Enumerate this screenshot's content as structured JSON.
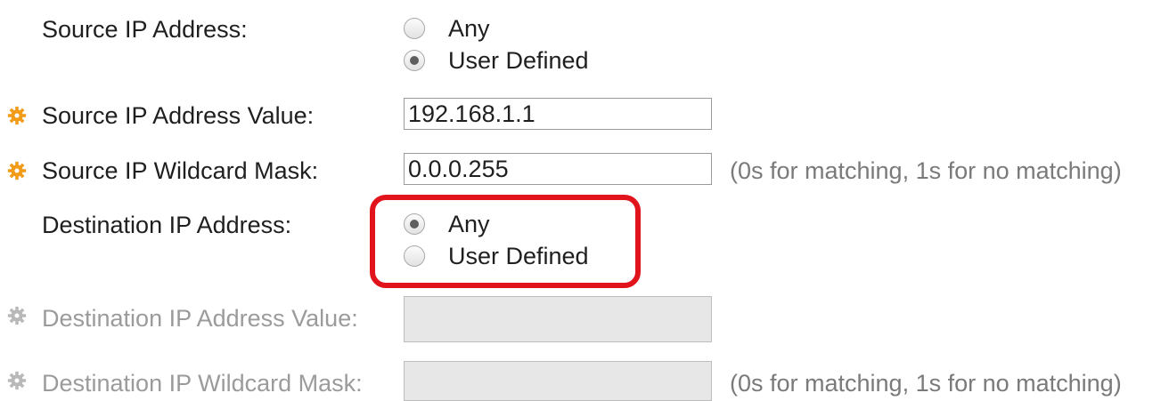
{
  "form": {
    "source_ip_address": {
      "label": "Source IP Address:",
      "options": [
        {
          "label": "Any",
          "checked": false
        },
        {
          "label": "User Defined",
          "checked": true
        }
      ]
    },
    "source_ip_address_value": {
      "label": "Source IP Address Value:",
      "value": "192.168.1.1",
      "required_icon": "gear-icon"
    },
    "source_ip_wildcard_mask": {
      "label": "Source IP Wildcard Mask:",
      "value": "0.0.0.255",
      "hint": "(0s for matching, 1s for no matching)",
      "required_icon": "gear-icon"
    },
    "destination_ip_address": {
      "label": "Destination IP Address:",
      "options": [
        {
          "label": "Any",
          "checked": true
        },
        {
          "label": "User Defined",
          "checked": false
        }
      ]
    },
    "destination_ip_address_value": {
      "label": "Destination IP Address Value:",
      "value": "",
      "required_icon": "gear-icon"
    },
    "destination_ip_wildcard_mask": {
      "label": "Destination IP Wildcard Mask:",
      "value": "",
      "hint": "(0s for matching, 1s for no matching)",
      "required_icon": "gear-icon"
    }
  },
  "colors": {
    "required_icon_active": "#f29b18",
    "required_icon_disabled": "#b9b9b9",
    "highlight": "#e1141c"
  }
}
